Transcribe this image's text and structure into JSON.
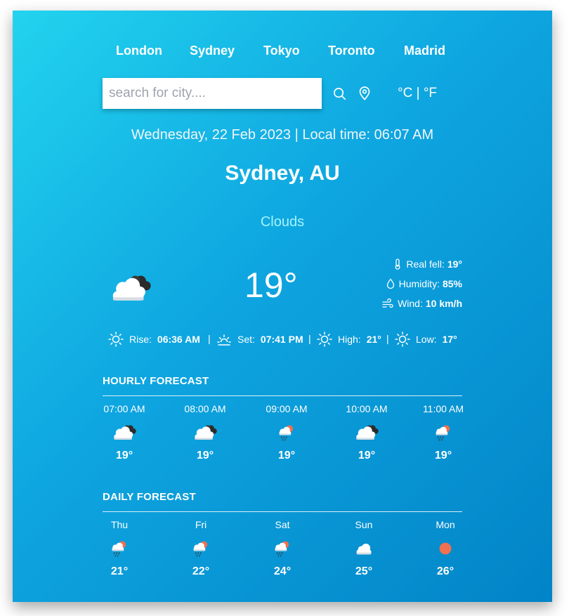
{
  "cities": [
    "London",
    "Sydney",
    "Tokyo",
    "Toronto",
    "Madrid"
  ],
  "search": {
    "placeholder": "search for city....",
    "value": ""
  },
  "icons": {
    "search": "search-icon",
    "location": "location-pin-icon"
  },
  "units": {
    "celsius": "°C",
    "separator": "|",
    "fahrenheit": "°F"
  },
  "datetime": "Wednesday, 22 Feb 2023 | Local time: 06:07 AM",
  "location": "Sydney, AU",
  "condition": "Clouds",
  "current": {
    "icon": "cloudy-icon",
    "temp": "19°",
    "real_feel": {
      "label": "Real fell:",
      "value": "19°"
    },
    "humidity": {
      "label": "Humidity:",
      "value": "85%"
    },
    "wind": {
      "label": "Wind:",
      "value": "10 km/h"
    }
  },
  "sun": {
    "rise": {
      "label": "Rise:",
      "value": "06:36 AM"
    },
    "set": {
      "label": "Set:",
      "value": "07:41 PM"
    },
    "high": {
      "label": "High:",
      "value": "21°"
    },
    "low": {
      "label": "Low:",
      "value": "17°"
    },
    "separator": "|"
  },
  "hourly": {
    "title": "HOURLY FORECAST",
    "items": [
      {
        "time": "07:00 AM",
        "icon": "cloudy-icon",
        "temp": "19°"
      },
      {
        "time": "08:00 AM",
        "icon": "cloudy-icon",
        "temp": "19°"
      },
      {
        "time": "09:00 AM",
        "icon": "rain-sun-icon",
        "temp": "19°"
      },
      {
        "time": "10:00 AM",
        "icon": "cloudy-icon",
        "temp": "19°"
      },
      {
        "time": "11:00 AM",
        "icon": "rain-sun-icon",
        "temp": "19°"
      }
    ]
  },
  "daily": {
    "title": "DAILY FORECAST",
    "items": [
      {
        "day": "Thu",
        "icon": "rain-sun-icon",
        "temp": "21°"
      },
      {
        "day": "Fri",
        "icon": "rain-sun-icon",
        "temp": "22°"
      },
      {
        "day": "Sat",
        "icon": "rain-sun-icon",
        "temp": "24°"
      },
      {
        "day": "Sun",
        "icon": "cloud-icon",
        "temp": "25°"
      },
      {
        "day": "Mon",
        "icon": "sun-icon",
        "temp": "26°"
      }
    ]
  },
  "colors": {
    "gradient_start": "#22d3ee",
    "gradient_end": "#0284c7",
    "condition_text": "#a5f3fc",
    "sun": "#f0704f"
  }
}
